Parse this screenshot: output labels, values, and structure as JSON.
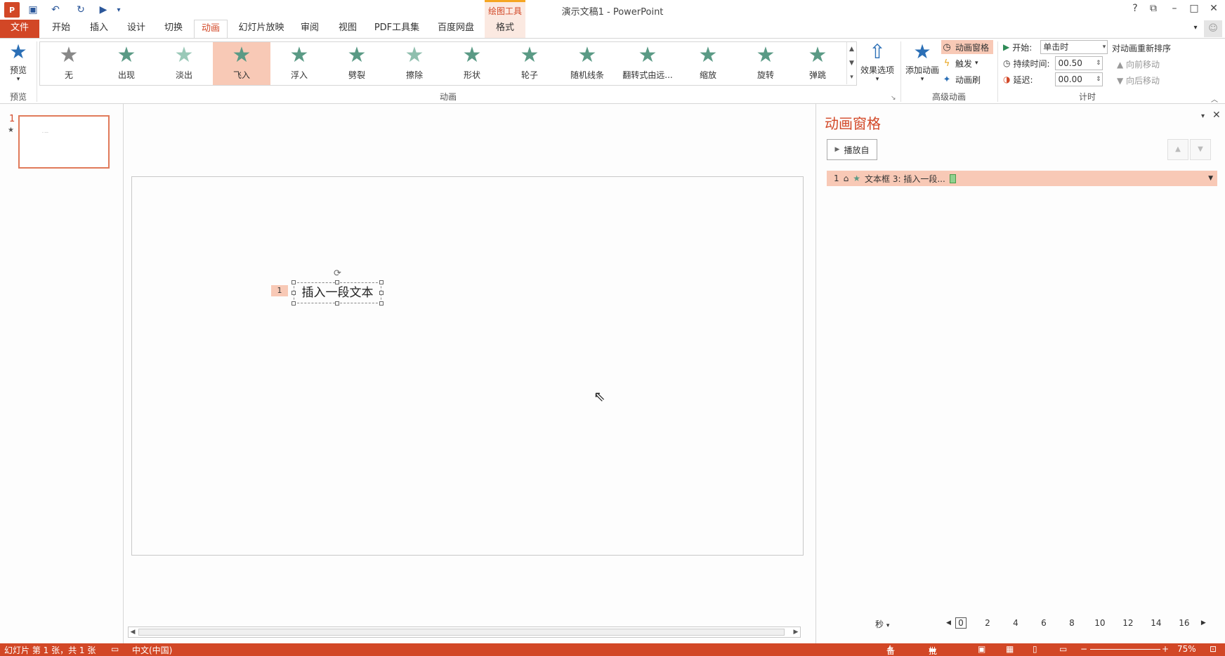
{
  "window": {
    "title": "演示文稿1 - PowerPoint",
    "app_logo": "P",
    "context_tab": "绘图工具",
    "help": "?",
    "ribbon_display": "⧉",
    "minimize": "–",
    "maximize": "□",
    "close": "✕"
  },
  "qat": {
    "save_icon": "save-icon",
    "undo": "↶",
    "redo": "↻",
    "slideshow": "▶"
  },
  "tabs": [
    {
      "label": "文件"
    },
    {
      "label": "开始"
    },
    {
      "label": "插入"
    },
    {
      "label": "设计"
    },
    {
      "label": "切换"
    },
    {
      "label": "动画"
    },
    {
      "label": "幻灯片放映"
    },
    {
      "label": "审阅"
    },
    {
      "label": "视图"
    },
    {
      "label": "PDF工具集"
    },
    {
      "label": "百度网盘"
    },
    {
      "label": "格式"
    }
  ],
  "ribbon": {
    "preview": {
      "label": "预览",
      "group": "预览"
    },
    "animations": [
      {
        "label": "无"
      },
      {
        "label": "出现"
      },
      {
        "label": "淡出"
      },
      {
        "label": "飞入"
      },
      {
        "label": "浮入"
      },
      {
        "label": "劈裂"
      },
      {
        "label": "擦除"
      },
      {
        "label": "形状"
      },
      {
        "label": "轮子"
      },
      {
        "label": "随机线条"
      },
      {
        "label": "翻转式由远..."
      },
      {
        "label": "缩放"
      },
      {
        "label": "旋转"
      },
      {
        "label": "弹跳"
      }
    ],
    "animation_group": "动画",
    "effect_options": "效果选项",
    "add_animation": "添加动画",
    "animation_pane": "动画窗格",
    "trigger": "触发",
    "animation_painter": "动画刷",
    "advanced_group": "高级动画",
    "timing": {
      "start_label": "开始:",
      "start_value": "单击时",
      "duration_label": "持续时间:",
      "duration_value": "00.50",
      "delay_label": "延迟:",
      "delay_value": "00.00",
      "group": "计时"
    },
    "reorder": {
      "title": "对动画重新排序",
      "earlier": "向前移动",
      "later": "向后移动"
    }
  },
  "thumbnails": {
    "number": "1",
    "star": "★",
    "mini_text": "- ---"
  },
  "slide": {
    "anim_tag": "1",
    "text": "插入一段文本"
  },
  "anim_pane": {
    "title": "动画窗格",
    "play_from": "播放自",
    "item": {
      "number": "1",
      "name": "文本框 3: 插入一段..."
    },
    "seconds": "秒",
    "ticks": [
      "0",
      "2",
      "4",
      "6",
      "8",
      "10",
      "12",
      "14",
      "16"
    ]
  },
  "status": {
    "slide_info": "幻灯片 第 1 张，共 1 张",
    "language": "中文(中国)",
    "notes": "备注",
    "comments": "批注",
    "zoom": "75%"
  },
  "colors": {
    "accent": "#d24726",
    "selected": "#f8c9b6",
    "star": "#5a9a85"
  }
}
